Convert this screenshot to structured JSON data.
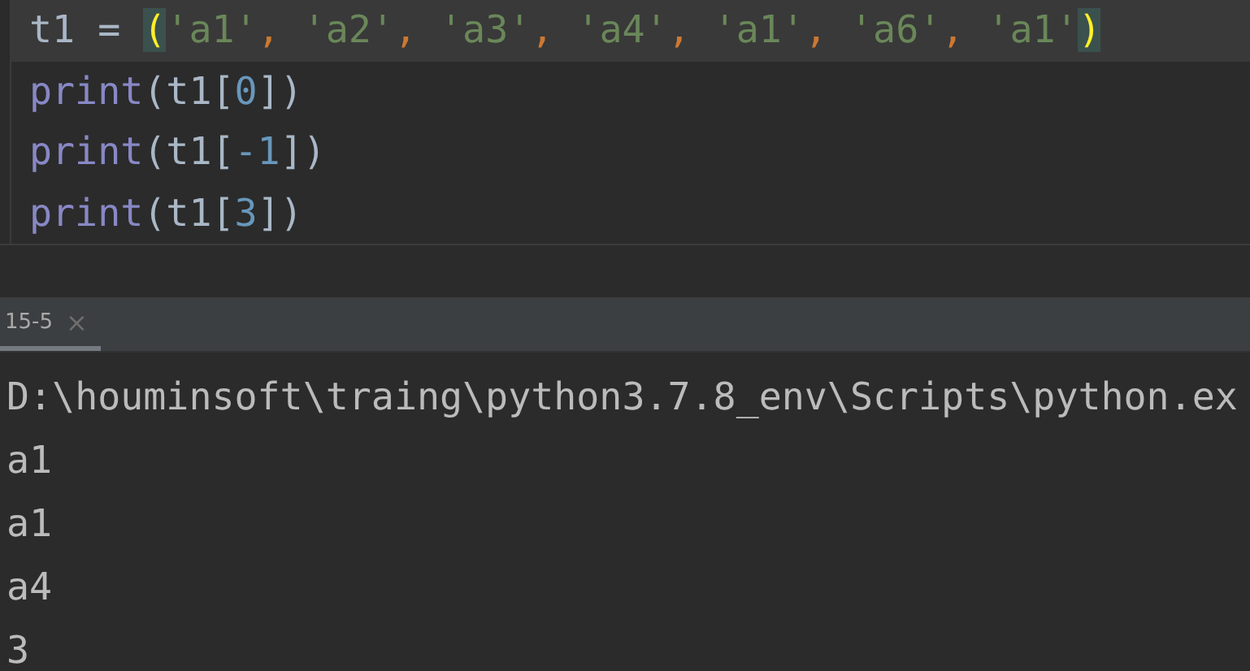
{
  "editor": {
    "lines": [
      {
        "current": true,
        "tokens": [
          {
            "kind": "ident",
            "text": "t1 = "
          },
          {
            "kind": "paren_match",
            "text": "("
          },
          {
            "kind": "string",
            "text": "'a1'"
          },
          {
            "kind": "comma",
            "text": ", "
          },
          {
            "kind": "string",
            "text": "'a2'"
          },
          {
            "kind": "comma",
            "text": ", "
          },
          {
            "kind": "string",
            "text": "'a3'"
          },
          {
            "kind": "comma",
            "text": ", "
          },
          {
            "kind": "string",
            "text": "'a4'"
          },
          {
            "kind": "comma",
            "text": ", "
          },
          {
            "kind": "string",
            "text": "'a1'"
          },
          {
            "kind": "comma",
            "text": ", "
          },
          {
            "kind": "string",
            "text": "'a6'"
          },
          {
            "kind": "comma",
            "text": ", "
          },
          {
            "kind": "string",
            "text": "'a1'"
          },
          {
            "kind": "paren_match",
            "text": ")"
          }
        ]
      },
      {
        "current": false,
        "tokens": [
          {
            "kind": "builtin",
            "text": "print"
          },
          {
            "kind": "ident",
            "text": "(t1["
          },
          {
            "kind": "number",
            "text": "0"
          },
          {
            "kind": "ident",
            "text": "])"
          }
        ]
      },
      {
        "current": false,
        "tokens": [
          {
            "kind": "builtin",
            "text": "print"
          },
          {
            "kind": "ident",
            "text": "(t1["
          },
          {
            "kind": "number",
            "text": "-1"
          },
          {
            "kind": "ident",
            "text": "])"
          }
        ]
      },
      {
        "current": false,
        "tokens": [
          {
            "kind": "builtin",
            "text": "print"
          },
          {
            "kind": "ident",
            "text": "(t1["
          },
          {
            "kind": "number",
            "text": "3"
          },
          {
            "kind": "ident",
            "text": "])"
          }
        ]
      }
    ]
  },
  "run_tabs": [
    {
      "label": "15-5",
      "close": "×",
      "selected": true
    }
  ],
  "console": {
    "lines": [
      "D:\\houminsoft\\traing\\python3.7.8_env\\Scripts\\python.ex",
      "a1",
      "a1",
      "a4",
      "3"
    ]
  }
}
